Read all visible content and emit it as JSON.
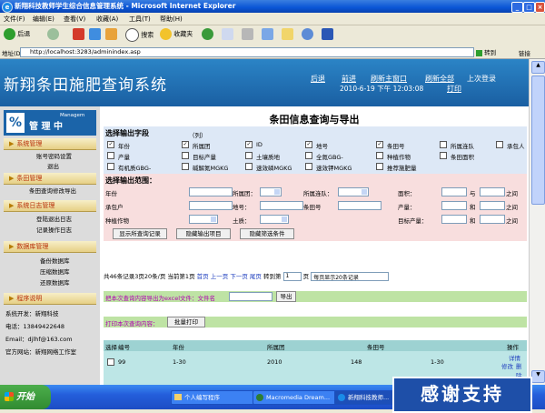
{
  "window": {
    "title": "新翔科技教师学生综合信息管理系统 - Microsoft Internet Explorer"
  },
  "menu": [
    "文件(F)",
    "编辑(E)",
    "查看(V)",
    "收藏(A)",
    "工具(T)",
    "帮助(H)"
  ],
  "toolbar": {
    "back": "后退",
    "search": "搜索",
    "favorites": "收藏夹"
  },
  "address": {
    "label": "地址(D)",
    "url": "http://localhost:3283/adminindex.asp",
    "go": "转到",
    "links": "链接"
  },
  "header": {
    "system_name": "新翔条田施肥查询系统",
    "links": [
      "后退",
      "前进",
      "刷新主窗口",
      "刷新全部",
      "上次登录",
      "打印"
    ],
    "datetime": "2010-6-19 下午 12:03:08"
  },
  "left": {
    "logo_text": "管 理 中",
    "logo_sub": "Managem",
    "sections": [
      {
        "title": "系统管理",
        "items": [
          "账号密码设置",
          "退出"
        ]
      },
      {
        "title": "条田管理",
        "items": [
          "条田查询修改导出"
        ]
      },
      {
        "title": "系统日志管理",
        "items": [
          "登陆退出日志",
          "记录操作日志"
        ]
      },
      {
        "title": "数据库管理",
        "items": [
          "备份数据库",
          "压缩数据库",
          "还原数据库"
        ]
      },
      {
        "title": "程序说明",
        "items": []
      }
    ],
    "footer": [
      "系统开发：新翔科技",
      "电话：13849422648",
      "Email：djlhf@163.com",
      "官方网站：新翔网络工作室"
    ]
  },
  "main": {
    "title": "条田信息查询与导出",
    "fields_title": "选择输出字段",
    "fields_hint": "（列）",
    "fields": [
      {
        "label": "年份",
        "checked": true
      },
      {
        "label": "所属团",
        "checked": true
      },
      {
        "label": "ID",
        "checked": true
      },
      {
        "label": "地号",
        "checked": true
      },
      {
        "label": "条田号",
        "checked": true
      },
      {
        "label": "所属连队",
        "checked": false
      },
      {
        "label": "承包人",
        "checked": false
      },
      {
        "label": "产量",
        "checked": false
      },
      {
        "label": "目标产量",
        "checked": false
      },
      {
        "label": "土壤质地",
        "checked": false
      },
      {
        "label": "全氮GBG-",
        "checked": false
      },
      {
        "label": "种植作物",
        "checked": false
      },
      {
        "label": "条田面积",
        "checked": false
      },
      {
        "label": "有机质GBG-",
        "checked": false
      },
      {
        "label": "碱解氮MGKG",
        "checked": false
      },
      {
        "label": "速效磷MGKG",
        "checked": false
      },
      {
        "label": "速效钾MGKG",
        "checked": false
      },
      {
        "label": "推荐施肥量",
        "checked": false
      }
    ],
    "range_title": "选择输出范围：",
    "range_labels": [
      "年份",
      "所属团：",
      "所属连队：",
      "面积：",
      "与",
      "之间",
      "承包户",
      "地号：",
      "条田号",
      "产量：",
      "和",
      "之间",
      "种植作物",
      "土质：",
      "目标产量：",
      "和",
      "之间"
    ],
    "buttons": [
      "显示所查询记录",
      "隐藏输出项目",
      "隐藏筛选条件"
    ],
    "pager": {
      "summary": "共46条记录3页20条/页 当前第1页",
      "first": "首页",
      "prev": "上一页",
      "next": "下一页",
      "last": "尾页",
      "goto": "转到第",
      "page_value": "1",
      "page_unit": "页",
      "per_page": "每页显示20条记录"
    },
    "export_text": "把本次查询内容导出为excel文件：文件名",
    "export_button": "导出",
    "print_text": "打印本次查询内容：",
    "print_button": "批量打印",
    "table": {
      "headers": [
        "选择",
        "编号",
        "年份",
        "所属团",
        "条田号",
        "操作"
      ],
      "row": {
        "id": "99",
        "year": "1-30",
        "group": "2010",
        "team": "148",
        "field": "1-30",
        "ops": [
          "详情",
          "修改",
          "删除"
        ]
      }
    }
  },
  "taskbar": {
    "start": "开始",
    "tasks": [
      "个人编写程序",
      "Macromedia Dream...",
      "新翔科技教师..."
    ]
  },
  "watermark": "感谢支持"
}
